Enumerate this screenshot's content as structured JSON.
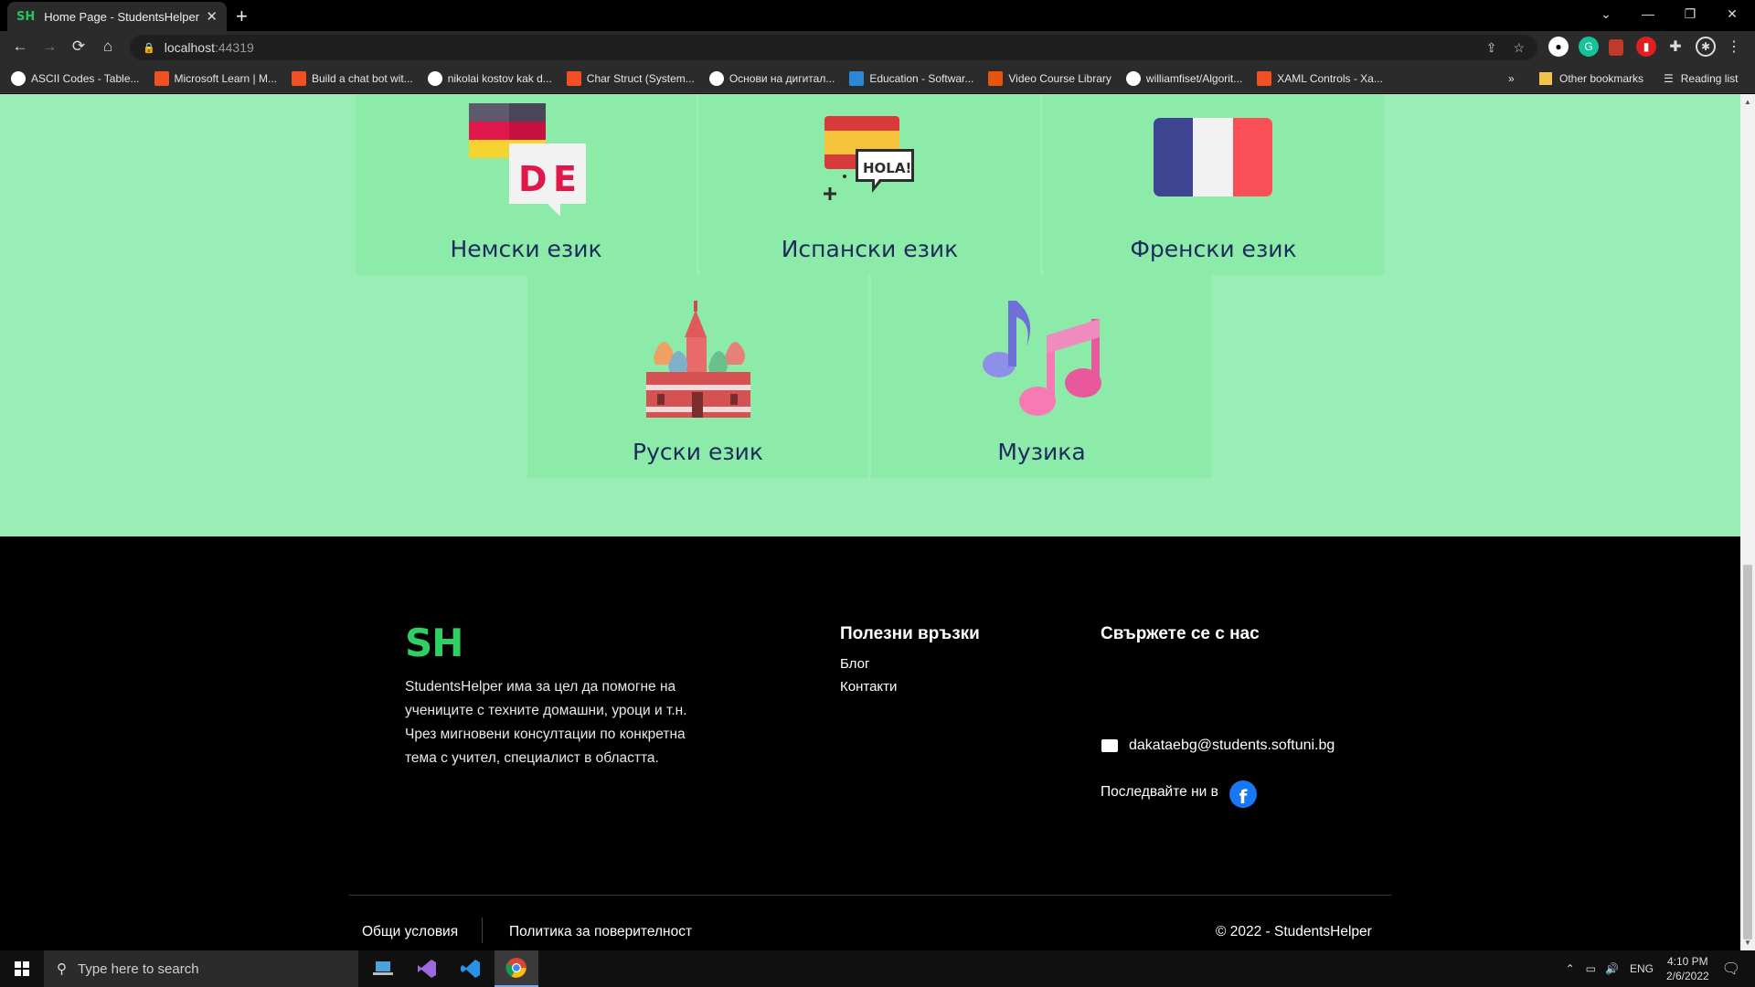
{
  "browser": {
    "tab_favicon": "SH",
    "tab_title": "Home Page - StudentsHelper",
    "tab_close": "✕",
    "new_tab": "+",
    "url_host": "localhost",
    "url_port": ":44319",
    "bookmarks": [
      {
        "label": "ASCII Codes - Table...",
        "color": "#ffffff"
      },
      {
        "label": "Microsoft Learn | M...",
        "color": "#f25022"
      },
      {
        "label": "Build a chat bot wit...",
        "color": "#f25022"
      },
      {
        "label": "nikolai kostov kak d...",
        "color": "#ffffff"
      },
      {
        "label": "Char Struct (System...",
        "color": "#f25022"
      },
      {
        "label": "Основи на дигитал...",
        "color": "#ffffff"
      },
      {
        "label": "Education - Softwar...",
        "color": "#2b88d8"
      },
      {
        "label": "Video Course Library",
        "color": "#e8540c"
      },
      {
        "label": "williamfiset/Algorit...",
        "color": "#ffffff"
      },
      {
        "label": "XAML Controls - Xa...",
        "color": "#f25022"
      }
    ],
    "bookmarks_more": "»",
    "other_bookmarks": "Other bookmarks",
    "reading_list": "Reading list"
  },
  "cards": [
    {
      "label": "Немски език",
      "icon": "germany-flag-icon"
    },
    {
      "label": "Испански език",
      "icon": "spain-hola-icon"
    },
    {
      "label": "Френски език",
      "icon": "france-flag-icon"
    },
    {
      "label": "Руски език",
      "icon": "russia-cathedral-icon"
    },
    {
      "label": "Музика",
      "icon": "music-notes-icon"
    }
  ],
  "footer": {
    "logo": "SH",
    "about": "StudentsHelper има за цел да помогне на учениците с техните домашни, уроци и т.н. Чрез мигновени консултации по конкретна тема с учител, специалист в областта.",
    "links_title": "Полезни връзки",
    "links": [
      "Блог",
      "Контакти"
    ],
    "contact_title": "Свържете се с нас",
    "email": "dakataebg@students.softuni.bg",
    "follow": "Последвайте ни в",
    "fb_letter": "f",
    "terms": "Общи условия",
    "privacy": "Политика за поверителност",
    "copyright": "© 2022 - StudentsHelper"
  },
  "taskbar": {
    "search_placeholder": "Type here to search",
    "lang": "ENG",
    "time": "4:10 PM",
    "date": "2/6/2022"
  },
  "colors": {
    "page_bg": "#9aeeb5",
    "card_bg": "#8deba9",
    "accent": "#2fd063",
    "label": "#1d2b5c"
  }
}
